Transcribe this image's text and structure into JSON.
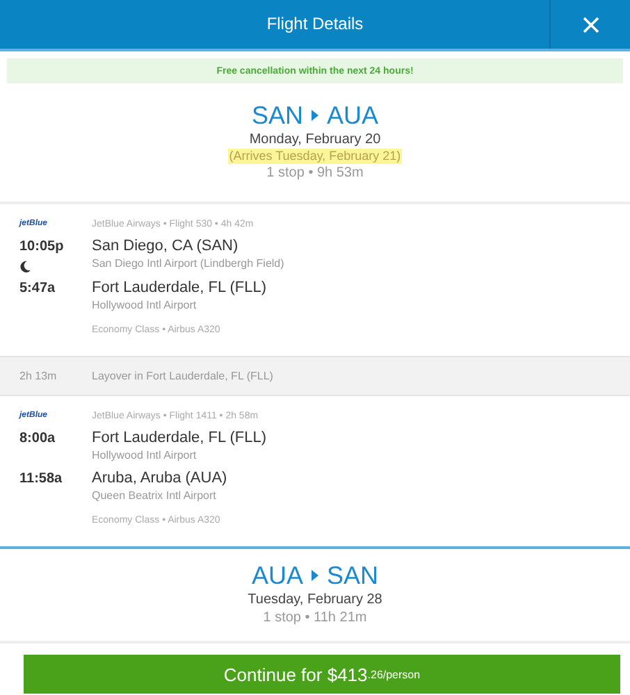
{
  "header": {
    "title": "Flight Details"
  },
  "notice": "Free cancellation within the next 24 hours!",
  "trips": [
    {
      "origin": "SAN",
      "destination": "AUA",
      "date": "Monday, February 20",
      "arrival_note": "(Arrives Tuesday, February 21)",
      "summary": "1 stop • 9h 53m",
      "items": [
        {
          "kind": "segment",
          "logo": "jetBlue",
          "info": "JetBlue Airways • Flight 530 • 4h 42m",
          "overnight": true,
          "depart_time": "10:05p",
          "depart_city": "San Diego, CA (SAN)",
          "depart_airport": "San Diego Intl Airport (Lindbergh Field)",
          "arrive_time": "5:47a",
          "arrive_city": "Fort Lauderdale, FL (FLL)",
          "arrive_airport": "Hollywood Intl Airport",
          "cabin": "Economy Class • Airbus A320"
        },
        {
          "kind": "layover",
          "duration": "2h 13m",
          "text": "Layover in Fort Lauderdale, FL (FLL)"
        },
        {
          "kind": "segment",
          "logo": "jetBlue",
          "info": "JetBlue Airways • Flight 1411 • 2h 58m",
          "overnight": false,
          "depart_time": "8:00a",
          "depart_city": "Fort Lauderdale, FL (FLL)",
          "depart_airport": "Hollywood Intl Airport",
          "arrive_time": "11:58a",
          "arrive_city": "Aruba, Aruba (AUA)",
          "arrive_airport": "Queen Beatrix Intl Airport",
          "cabin": "Economy Class • Airbus A320"
        }
      ]
    },
    {
      "origin": "AUA",
      "destination": "SAN",
      "date": "Tuesday, February 28",
      "summary": "1 stop • 11h 21m"
    }
  ],
  "continue_button": {
    "label": "Continue for $413",
    "suffix": ".26/person"
  }
}
